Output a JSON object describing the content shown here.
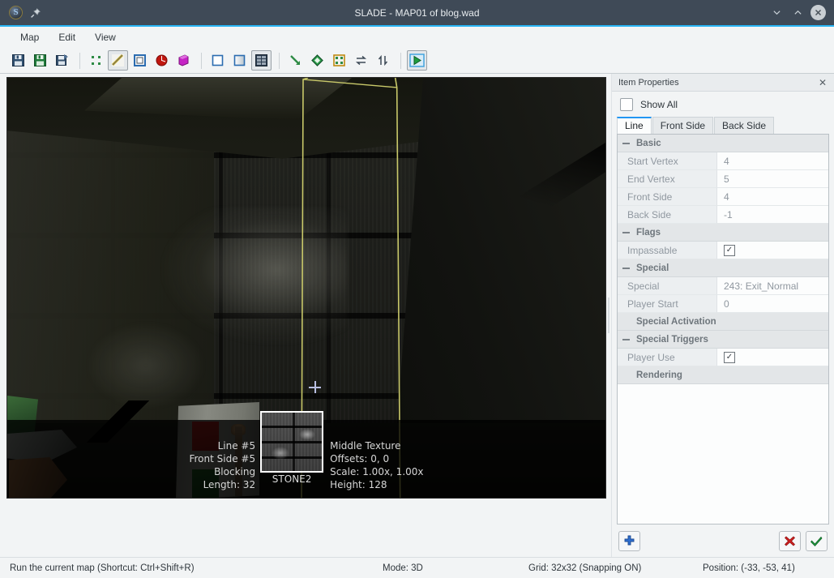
{
  "window": {
    "title": "SLADE - MAP01 of blog.wad",
    "logo_icon": "slade-logo-icon",
    "pin_icon": "pin-icon",
    "minimize_label": "⌄",
    "maximize_label": "⌃",
    "close_label": "✕"
  },
  "menubar": {
    "items": [
      {
        "label": "Map"
      },
      {
        "label": "Edit"
      },
      {
        "label": "View"
      }
    ]
  },
  "toolbar": {
    "groups": [
      {
        "tools": [
          {
            "name": "save-icon",
            "tip": "Save"
          },
          {
            "name": "save-all-icon",
            "tip": "Save All"
          },
          {
            "name": "save-as-icon",
            "tip": "Save As"
          }
        ]
      },
      {
        "tools": [
          {
            "name": "vertices-mode-icon",
            "tip": "Vertices Mode"
          },
          {
            "name": "lines-mode-icon",
            "tip": "Lines Mode",
            "active": true
          },
          {
            "name": "sectors-mode-icon",
            "tip": "Sectors Mode"
          },
          {
            "name": "things-mode-icon",
            "tip": "Things Mode"
          },
          {
            "name": "3d-mode-icon",
            "tip": "3D Mode"
          }
        ]
      },
      {
        "tools": [
          {
            "name": "show-all-icon",
            "tip": "Show All"
          },
          {
            "name": "fade-icon",
            "tip": "Fade"
          },
          {
            "name": "texture-view-icon",
            "tip": "Textured View",
            "active": true
          }
        ]
      },
      {
        "tools": [
          {
            "name": "draw-lines-icon",
            "tip": "Draw Lines"
          },
          {
            "name": "draw-shape-icon",
            "tip": "Draw Shape"
          },
          {
            "name": "edit-objects-icon",
            "tip": "Edit Objects"
          },
          {
            "name": "mirror-horizontal-icon",
            "tip": "Mirror Horizontally"
          },
          {
            "name": "mirror-vertical-icon",
            "tip": "Mirror Vertically"
          }
        ]
      },
      {
        "tools": [
          {
            "name": "run-map-icon",
            "tip": "Run Map",
            "active": true
          }
        ]
      }
    ]
  },
  "viewport": {
    "overlay": {
      "left_lines": [
        "Line #5",
        "Front Side #5",
        "Blocking",
        "Length: 32"
      ],
      "texture_name": "STONE2",
      "right_lines": [
        "Middle Texture",
        "Offsets: 0, 0",
        "Scale: 1.00x, 1.00x",
        "Height: 128"
      ]
    },
    "highlight_color": "#c9c96a",
    "crosshair_color": "#b9bfe2"
  },
  "properties": {
    "panel_title": "Item Properties",
    "close_label": "✕",
    "show_all_label": "Show All",
    "show_all_checked": false,
    "tabs": [
      {
        "label": "Line",
        "active": true
      },
      {
        "label": "Front Side",
        "active": false
      },
      {
        "label": "Back Side",
        "active": false
      }
    ],
    "groups": [
      {
        "name": "Basic",
        "collapsible": true,
        "rows": [
          {
            "key": "Start Vertex",
            "value": "4",
            "type": "text"
          },
          {
            "key": "End Vertex",
            "value": "5",
            "type": "text"
          },
          {
            "key": "Front Side",
            "value": "4",
            "type": "text"
          },
          {
            "key": "Back Side",
            "value": "-1",
            "type": "text"
          }
        ]
      },
      {
        "name": "Flags",
        "collapsible": true,
        "rows": [
          {
            "key": "Impassable",
            "value": "✓",
            "type": "check"
          }
        ]
      },
      {
        "name": "Special",
        "collapsible": true,
        "rows": [
          {
            "key": "Special",
            "value": "243: Exit_Normal",
            "type": "text"
          },
          {
            "key": "Player Start",
            "value": "0",
            "type": "text"
          }
        ]
      },
      {
        "name": "Special Activation",
        "collapsible": false,
        "rows": []
      },
      {
        "name": "Special Triggers",
        "collapsible": true,
        "rows": [
          {
            "key": "Player Use",
            "value": "✓",
            "type": "check"
          }
        ]
      },
      {
        "name": "Rendering",
        "collapsible": false,
        "rows": []
      }
    ],
    "footer": {
      "add_icon": "plus-icon",
      "cancel_icon": "red-x-icon",
      "apply_icon": "green-check-icon"
    }
  },
  "statusbar": {
    "hint": "Run the current map (Shortcut: Ctrl+Shift+R)",
    "mode": "Mode: 3D",
    "grid": "Grid: 32x32 (Snapping ON)",
    "position": "Position: (-33, -53, 41)"
  },
  "colors": {
    "titlebar": "#3f4a57",
    "accent": "#29b6f6",
    "chrome": "#f2f4f5",
    "highlight_yellow": "#c9c96a"
  }
}
